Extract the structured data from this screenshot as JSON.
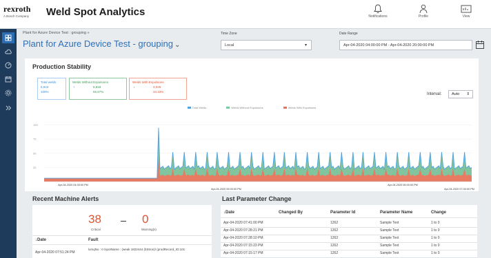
{
  "app": {
    "brand": "rexroth",
    "brand_sub": "A Bosch Company",
    "title": "Weld Spot Analytics"
  },
  "header_actions": [
    {
      "label": "Notifications",
      "icon": "bell-icon"
    },
    {
      "label": "Profile",
      "icon": "user-icon"
    },
    {
      "label": "View",
      "icon": "view-icon"
    }
  ],
  "filters": {
    "breadcrumb": "Plant for Azure Device Test : grouping »",
    "plant_title": "Plant for Azure Device Test - grouping",
    "timezone_label": "Time Zone",
    "timezone_value": "Local",
    "daterange_label": "Date Range",
    "daterange_value": "Apr-04-2020 04:00:00 PM - Apr-04-2020 20:00:00 PM"
  },
  "production": {
    "title": "Production Stability",
    "tiles": [
      {
        "label": "Total welds",
        "count": "8,843",
        "pct": "100%",
        "color": "#3b8fd6"
      },
      {
        "label": "Welds Without Expulsions",
        "arrow": "↑",
        "count": "5,818",
        "pct": "65.67%",
        "color": "#3d9a53"
      },
      {
        "label": "Welds With Expulsions",
        "arrow": "↓",
        "count": "3,025",
        "pct": "34.33%",
        "color": "#e2522f"
      }
    ],
    "interval_label": "Interval:",
    "interval_value": "Auto"
  },
  "chart_data": {
    "type": "area",
    "y_ticks": [
      "100",
      "75",
      "50",
      "25"
    ],
    "x_labels": [
      "Apr-04-2020 04:00:00 PM",
      "Apr-04-2020 05:00:00 PM",
      "Apr-04-2020 06:00:00 PM",
      "Apr-04-2020 07:00:00 PM"
    ],
    "legend": [
      {
        "name": "Total Welds",
        "color": "#4fa3e0"
      },
      {
        "name": "Welds Without Expulsions",
        "color": "#7cc8a0"
      },
      {
        "name": "Welds With Expulsions",
        "color": "#e8735a"
      }
    ],
    "ylim": [
      0,
      120
    ],
    "baseline_total": 6,
    "first_peak_total": 95,
    "spike_total": 52,
    "typical_total": 25,
    "without_share": 0.55,
    "spike_count": 27
  },
  "alerts": {
    "title": "Recent Machine Alerts",
    "critical_count": "38",
    "critical_label": "Critical",
    "warning_count": "0",
    "warning_label": "Warning(s)",
    "columns": [
      "Date",
      "Fault"
    ],
    "rows": [
      {
        "date": "Apr-04-2020 07:51:24 PM",
        "fault": "lorsqNo : 0 /spotName : (weak 1822444 (bStron)/ (prodRecord_ID:101"
      }
    ]
  },
  "params": {
    "title": "Last Parameter Change",
    "columns": [
      "Date",
      "Changed By",
      "Parameter Id",
      "Parameter Name",
      "Change"
    ],
    "rows": [
      {
        "date": "Apr-04-2020 07:41:00 PM",
        "by": "",
        "id": "1262",
        "name": "Sample Text",
        "change": "1 to 0"
      },
      {
        "date": "Apr-04-2020 07:28:21 PM",
        "by": "",
        "id": "1262",
        "name": "Sample Text",
        "change": "1 to 0"
      },
      {
        "date": "Apr-04-2020 07:28:10 PM",
        "by": "",
        "id": "1262",
        "name": "Sample Text",
        "change": "1 to 0"
      },
      {
        "date": "Apr-04-2020 07:15:23 PM",
        "by": "",
        "id": "1262",
        "name": "Sample Text",
        "change": "1 to 0"
      },
      {
        "date": "Apr-04-2020 07:15:17 PM",
        "by": "",
        "id": "1262",
        "name": "Sample Text",
        "change": "1 to 0"
      }
    ]
  }
}
